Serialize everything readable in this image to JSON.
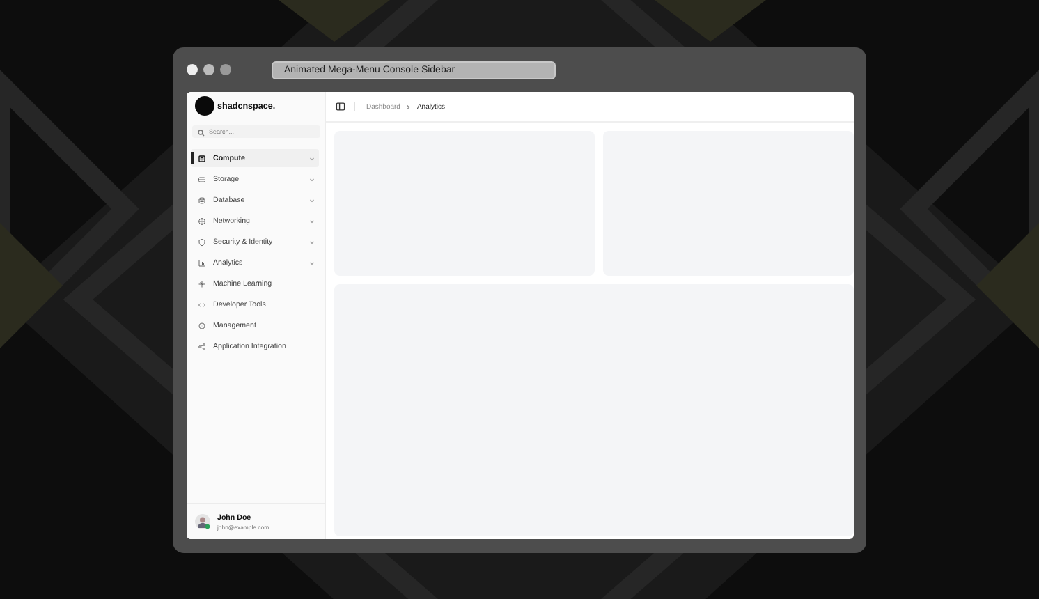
{
  "window": {
    "title": "Animated Mega-Menu Console Sidebar"
  },
  "sidebar": {
    "logo": "shadcnspace.",
    "search": {
      "placeholder": "Search..."
    },
    "items": [
      {
        "label": "Compute",
        "expandable": true,
        "selected": true
      },
      {
        "label": "Storage",
        "expandable": true,
        "selected": false
      },
      {
        "label": "Database",
        "expandable": true,
        "selected": false
      },
      {
        "label": "Networking",
        "expandable": true,
        "selected": false
      },
      {
        "label": "Security & Identity",
        "expandable": true,
        "selected": false
      },
      {
        "label": "Analytics",
        "expandable": true,
        "selected": false
      },
      {
        "label": "Machine Learning",
        "expandable": false,
        "selected": false
      },
      {
        "label": "Developer Tools",
        "expandable": false,
        "selected": false
      },
      {
        "label": "Management",
        "expandable": false,
        "selected": false
      },
      {
        "label": "Application Integration",
        "expandable": false,
        "selected": false
      }
    ],
    "user": {
      "name": "John Doe",
      "email": "john@example.com"
    }
  },
  "breadcrumb": [
    {
      "label": "Dashboard",
      "current": false
    },
    {
      "label": "Analytics",
      "current": true
    }
  ]
}
